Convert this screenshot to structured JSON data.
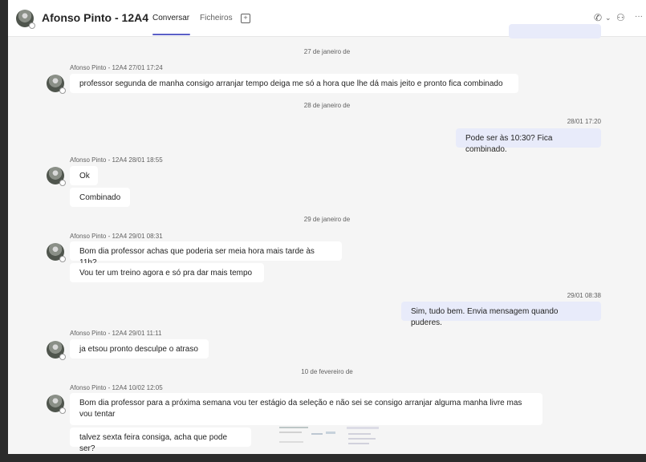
{
  "header": {
    "title": "Afonso Pinto - 12A4",
    "tabs": [
      {
        "label": "Conversar"
      },
      {
        "label": "Ficheiros"
      }
    ],
    "add_tab": "+",
    "call_icon": "✆",
    "chevron": "⌄",
    "people_icon": "⚇",
    "more_icon": "···"
  },
  "messages": {
    "d1": "27 de janeiro de",
    "m1_meta": "Afonso Pinto - 12A4  27/01 17:24",
    "m1_text": "professor segunda de manha consigo arranjar tempo deiga me só a hora que lhe dá mais jeito e pronto fica combinado",
    "d2": "28 de janeiro de",
    "s1_meta": "28/01 17:20",
    "s1_text": "Pode ser às 10:30? Fica combinado.",
    "m2_meta": "Afonso Pinto - 12A4  28/01 18:55",
    "m2_text1": "Ok",
    "m2_text2": "Combinado",
    "d3": "29 de janeiro de",
    "m3_meta": "Afonso Pinto - 12A4  29/01 08:31",
    "m3_text1": "Bom dia professor achas que poderia ser meia hora mais tarde às 11h?",
    "m3_text2": "Vou ter um treino agora e só pra dar mais tempo",
    "s2_meta": "29/01 08:38",
    "s2_text": "Sim, tudo bem. Envia mensagem quando puderes.",
    "m4_meta": "Afonso Pinto - 12A4  29/01 11:11",
    "m4_text": "ja etsou pronto desculpe o atraso",
    "d4": "10 de fevereiro de",
    "m5_meta": "Afonso Pinto - 12A4  10/02 12:05",
    "m5_text1": "Bom dia professor para a próxima semana vou ter estágio da seleção e não sei se consigo arranjar alguma manha livre mas vou tentar",
    "m5_text2": "talvez sexta feira consiga, acha que pode ser?"
  }
}
